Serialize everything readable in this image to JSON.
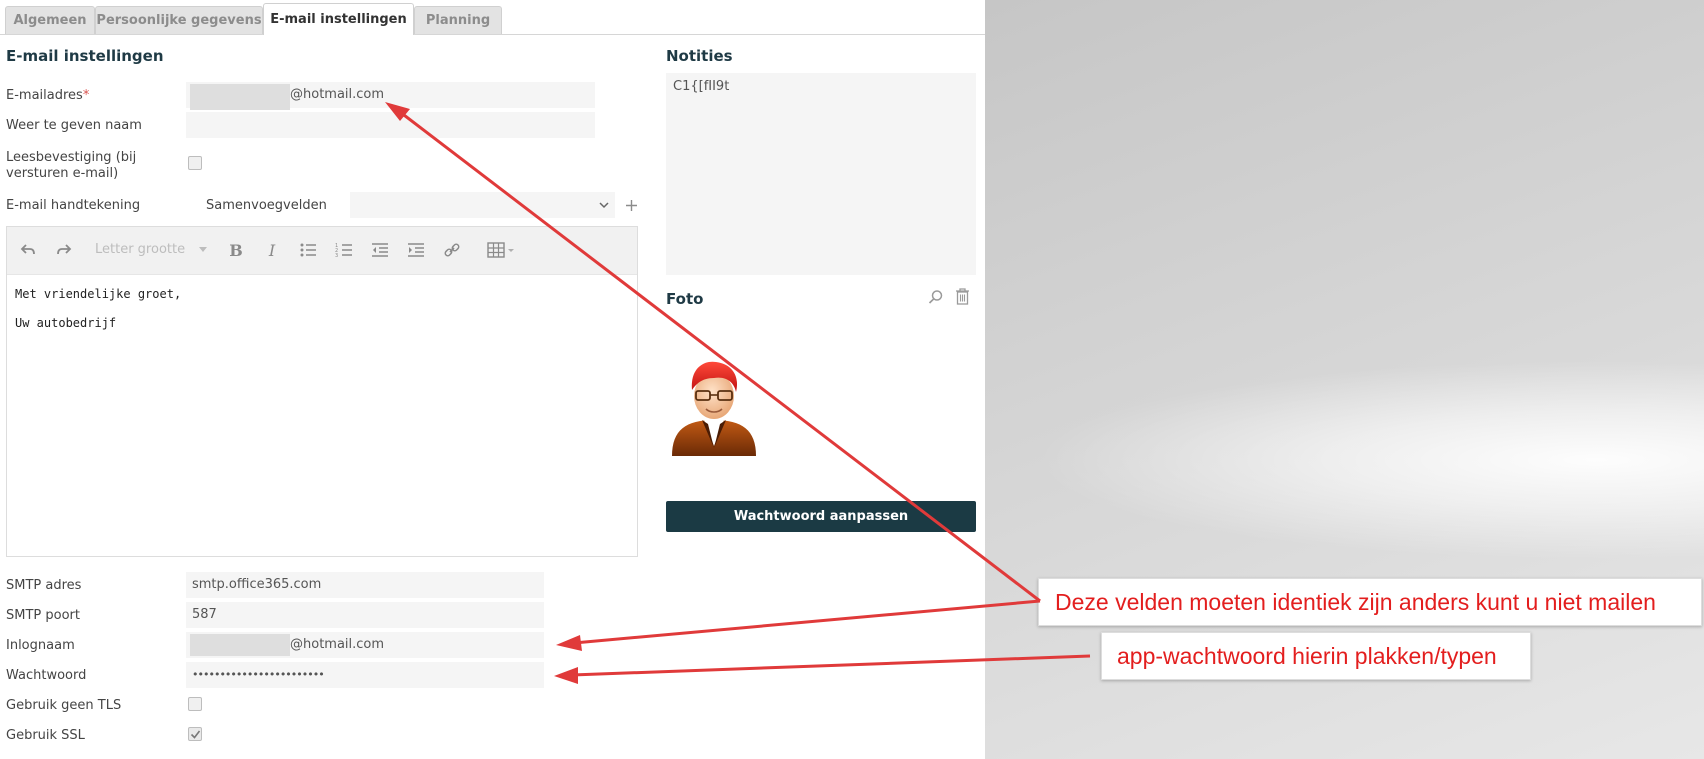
{
  "tabs": [
    {
      "label": "Algemeen"
    },
    {
      "label": "Persoonlijke gegevens"
    },
    {
      "label": "E-mail instellingen"
    },
    {
      "label": "Planning"
    }
  ],
  "email_settings": {
    "title": "E-mail instellingen",
    "email_label": "E-mailadres",
    "email_required": "*",
    "email_value": "@hotmail.com",
    "display_name_label": "Weer te geven naam",
    "display_name_value": "",
    "read_receipt_label": "Leesbevestiging (bij versturen e-mail)",
    "read_receipt_checked": false,
    "signature_label": "E-mail handtekening",
    "merge_fields_label": "Samenvoegvelden",
    "merge_fields_value": ""
  },
  "editor": {
    "font_size_label": "Letter grootte",
    "line1": "Met vriendelijke groet,",
    "line2": "Uw autobedrijf"
  },
  "smtp": {
    "address_label": "SMTP adres",
    "address_value": "smtp.office365.com",
    "port_label": "SMTP poort",
    "port_value": "587",
    "login_label": "Inlognaam",
    "login_value": "@hotmail.com",
    "password_label": "Wachtwoord",
    "password_value": "••••••••••••••••••••••••",
    "no_tls_label": "Gebruik geen TLS",
    "no_tls_checked": false,
    "ssl_label": "Gebruik SSL",
    "ssl_checked": true
  },
  "notes": {
    "title": "Notities",
    "value": "C1{[fII9t"
  },
  "photo": {
    "title": "Foto"
  },
  "change_password_button": "Wachtwoord aanpassen",
  "callouts": {
    "identical": "Deze velden moeten identiek zijn anders kunt u niet mailen",
    "app_password": "app-wachtwoord hierin plakken/typen"
  },
  "colors": {
    "annotation_red": "#e31e1e",
    "dark_button": "#1b3a44"
  }
}
